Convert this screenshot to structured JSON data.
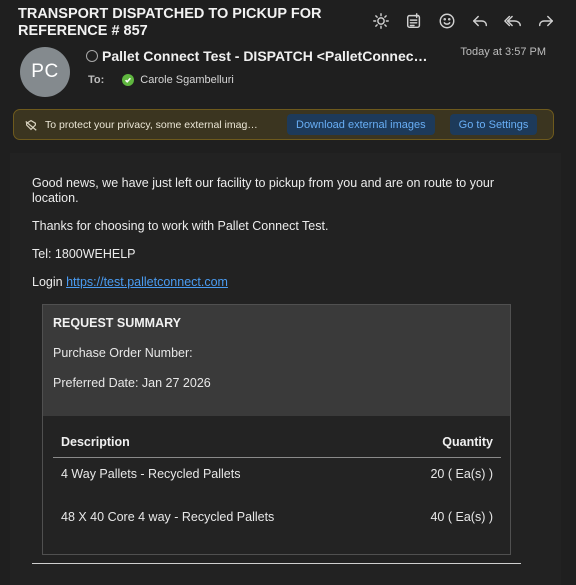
{
  "email": {
    "subject": "TRANSPORT DISPATCHED TO PICKUP FOR REFERENCE # 857",
    "sender": "Pallet Connect Test - DISPATCH <PalletConnec…",
    "avatar_initials": "PC",
    "date": "Today at 3:57 PM",
    "to_label": "To:",
    "recipient": "Carole Sgambelluri"
  },
  "toolbar": {
    "icons": [
      "brightness-icon",
      "note-icon",
      "emoji-icon",
      "reply-icon",
      "reply-all-icon",
      "forward-icon"
    ]
  },
  "privacy": {
    "text": "To protect your privacy, some external imag…",
    "download_label": "Download external images",
    "settings_label": "Go to Settings"
  },
  "body": {
    "paragraph1": "Good news, we have just left our facility to pickup from you and are on route to your location.",
    "paragraph2": "Thanks for choosing to work with Pallet Connect Test.",
    "tel": "Tel: 1800WEHELP",
    "login_label": "Login ",
    "login_link": "https://test.palletconnect.com"
  },
  "summary": {
    "title": "REQUEST SUMMARY",
    "po_label": "Purchase Order Number:",
    "preferred_date": "Preferred Date: Jan 27 2026"
  },
  "items": {
    "headers": {
      "description": "Description",
      "quantity": "Quantity"
    },
    "rows": [
      {
        "description": "4 Way Pallets - Recycled Pallets",
        "quantity": "20 ( Ea(s) )"
      },
      {
        "description": "48 X 40 Core 4 way - Recycled Pallets",
        "quantity": "40 ( Ea(s) )"
      }
    ]
  },
  "colors": {
    "background": "#1f1f1f",
    "link": "#4a9cf2",
    "privacy_bar": "#3b3520",
    "privacy_border": "#6e5a1d",
    "verified": "#5fb63f"
  }
}
